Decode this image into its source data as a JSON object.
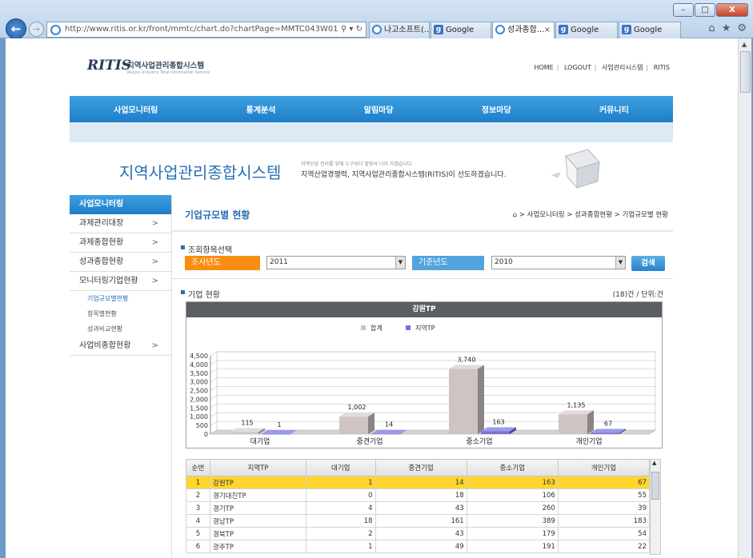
{
  "browser": {
    "address": "http://www.ritis.or.kr/front/mmtc/chart.do?chartPage=MMTC043W01",
    "tabs": [
      {
        "label": "나고소프트(..."
      },
      {
        "label": "Google"
      },
      {
        "label": "성과종합...",
        "active": true
      },
      {
        "label": "Google"
      },
      {
        "label": "Google"
      }
    ],
    "win_minimize": "–",
    "win_restore": "□",
    "win_close": "X",
    "back_glyph": "←",
    "fwd_glyph": "→",
    "addr_tools": "⚲ ▾ ↻",
    "tab_close": "×",
    "right_icons": [
      "⌂",
      "★",
      "⚙"
    ]
  },
  "site": {
    "logo": "RITIS",
    "logo_title": "지역사업관리종합시스템",
    "logo_subtitle": "Region Industry Total Information Service",
    "toplinks": [
      "HOME",
      "LOGOUT",
      "사업관리시스템",
      "RITIS"
    ],
    "toplink_sep": "|",
    "gnb": [
      "사업모니터링",
      "통계분석",
      "알림마당",
      "정보마당",
      "커뮤니티"
    ],
    "banner_title": "지역사업관리종합시스템",
    "banner_sub1": "지역산업 관리를 위해 누구보다 앞장서 나아 가겠습니다",
    "banner_sub2": "지역산업경쟁력, 지역사업관리종합시스템(RITIS)이 선도하겠습니다."
  },
  "lnb": {
    "title": "사업모니터링",
    "items": [
      {
        "label": "과제관리대장"
      },
      {
        "label": "과제종합현황"
      },
      {
        "label": "성과종합현황"
      },
      {
        "label": "모니터링기업현황"
      }
    ],
    "subitems": [
      {
        "label": "기업규모별현황",
        "active": true
      },
      {
        "label": "항목별현황"
      },
      {
        "label": "성과비교현황"
      }
    ],
    "last_item": "사업비종합현황",
    "arrow": ">"
  },
  "content": {
    "page_title": "기업규모별 현황",
    "breadcrumb": "⌂ > 사업모니터링 > 성과종합현황 > 기업규모별 현황",
    "search_section": "조회항목선택",
    "year_label": "조사년도",
    "year_value": "2011",
    "base_label": "기준년도",
    "base_value": "2010",
    "dropdown_glyph": "▼",
    "search_button": "검색",
    "company_section": "기업 현황",
    "count_text": "(18)건 / 단위:건",
    "chart_title": "강원TP",
    "colors": {
      "total": "#cdc4c3",
      "local": "#7474d8",
      "selected_row": "#ffd52e",
      "accent": "#2a6fb5"
    }
  },
  "chart_data": {
    "type": "bar",
    "title": "강원TP",
    "categories": [
      "대기업",
      "중견기업",
      "중소기업",
      "개인기업"
    ],
    "series": [
      {
        "name": "합계",
        "values": [
          115,
          1002,
          3740,
          1135
        ],
        "labels": [
          "115",
          "1,002",
          "3,740",
          "1,135"
        ]
      },
      {
        "name": "지역TP",
        "values": [
          1,
          14,
          163,
          67
        ],
        "labels": [
          "1",
          "14",
          "163",
          "67"
        ]
      }
    ],
    "yticks": [
      "0",
      "500",
      "1,000",
      "1,500",
      "2,000",
      "2,500",
      "3,000",
      "3,500",
      "4,000",
      "4,500"
    ],
    "ylim": [
      0,
      4500
    ],
    "legend": "top-center",
    "grid": true
  },
  "table": {
    "headers": [
      "순번",
      "지역TP",
      "대기업",
      "중견기업",
      "중소기업",
      "개인기업"
    ],
    "rows": [
      [
        "1",
        "강원TP",
        "1",
        "14",
        "163",
        "67"
      ],
      [
        "2",
        "경기대진TP",
        "0",
        "18",
        "106",
        "55"
      ],
      [
        "3",
        "경기TP",
        "4",
        "43",
        "260",
        "39"
      ],
      [
        "4",
        "경남TP",
        "18",
        "161",
        "389",
        "183"
      ],
      [
        "5",
        "경북TP",
        "2",
        "43",
        "179",
        "54"
      ],
      [
        "6",
        "광주TP",
        "1",
        "49",
        "191",
        "22"
      ]
    ],
    "scroll_up": "▲"
  }
}
